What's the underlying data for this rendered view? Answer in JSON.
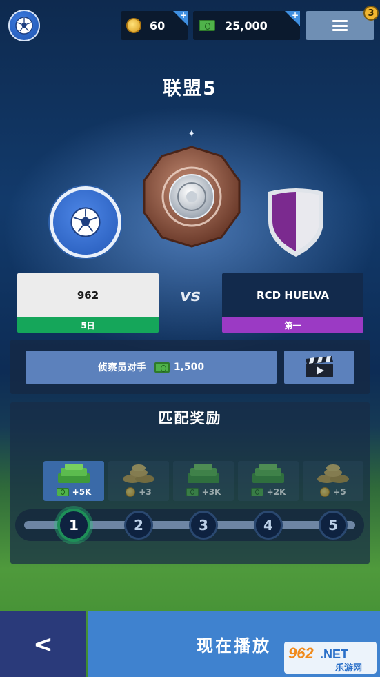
{
  "header": {
    "coins": "60",
    "coins_plus": "+",
    "cash": "25,000",
    "cash_plus": "+",
    "menu_badge": "3"
  },
  "league": {
    "title": "联盟5"
  },
  "match": {
    "home": {
      "name": "962",
      "rank": "5日",
      "rank_color": "#15a65a"
    },
    "vs": "vs",
    "away": {
      "name": "RCD HUELVA",
      "rank": "第一",
      "rank_color": "#9b3ac4"
    }
  },
  "scout": {
    "label": "侦察员对手",
    "cost": "1,500"
  },
  "rewards": {
    "title": "匹配奖励",
    "items": [
      {
        "type": "cash",
        "value": "+5K"
      },
      {
        "type": "coins",
        "value": "+3"
      },
      {
        "type": "cash",
        "value": "+3K"
      },
      {
        "type": "cash",
        "value": "+2K"
      },
      {
        "type": "coins",
        "value": "+5"
      }
    ],
    "steps": [
      "1",
      "2",
      "3",
      "4",
      "5"
    ],
    "current_step": 1
  },
  "footer": {
    "back": "<",
    "play": "现在播放"
  },
  "watermark": {
    "brand": "962.NET",
    "sub": "乐游网"
  },
  "colors": {
    "accent": "#3f82cf",
    "green": "#15a65a",
    "purple": "#9b3ac4"
  }
}
